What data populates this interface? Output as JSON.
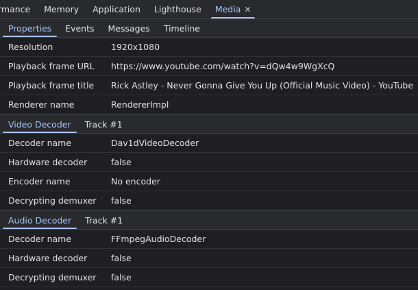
{
  "top_tabs": [
    {
      "label": "rmance",
      "active": false
    },
    {
      "label": "Memory",
      "active": false
    },
    {
      "label": "Application",
      "active": false
    },
    {
      "label": "Lighthouse",
      "active": false
    },
    {
      "label": "Media",
      "active": true
    }
  ],
  "media_close_icon": "close-icon",
  "sub_tabs": [
    "Properties",
    "Events",
    "Messages",
    "Timeline"
  ],
  "properties": [
    {
      "label": "Resolution",
      "value": "1920x1080"
    },
    {
      "label": "Playback frame URL",
      "value": "https://www.youtube.com/watch?v=dQw4w9WgXcQ"
    },
    {
      "label": "Playback frame title",
      "value": "Rick Astley - Never Gonna Give You Up (Official Music Video) - YouTube"
    },
    {
      "label": "Renderer name",
      "value": "RendererImpl"
    }
  ],
  "video_decoder": {
    "tabs": [
      "Video Decoder",
      "Track #1"
    ],
    "rows": [
      {
        "label": "Decoder name",
        "value": "Dav1dVideoDecoder"
      },
      {
        "label": "Hardware decoder",
        "value": "false"
      },
      {
        "label": "Encoder name",
        "value": "No encoder"
      },
      {
        "label": "Decrypting demuxer",
        "value": "false"
      }
    ]
  },
  "audio_decoder": {
    "tabs": [
      "Audio Decoder",
      "Track #1"
    ],
    "rows": [
      {
        "label": "Decoder name",
        "value": "FFmpegAudioDecoder"
      },
      {
        "label": "Hardware decoder",
        "value": "false"
      },
      {
        "label": "Decrypting demuxer",
        "value": "false"
      }
    ]
  },
  "colors": {
    "accent": "#a8c7fa",
    "background": "#1f1f23",
    "toolbar": "#282a2d"
  }
}
